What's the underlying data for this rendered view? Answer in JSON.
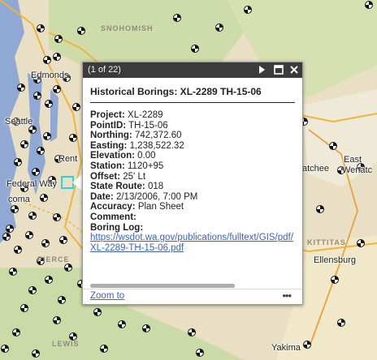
{
  "map": {
    "region_labels": [
      "SNOHOMISH",
      "KITTITAS",
      "PIERCE",
      "LEWIS"
    ],
    "cities": [
      "Edmonds",
      "Seattle",
      "Rent",
      "Federal Way",
      "coma",
      "East",
      "Wenatc",
      "atchee",
      "Ellensburg",
      "Yakima"
    ]
  },
  "popup": {
    "pager": "(1 of 22)",
    "title": "Historical Borings: XL-2289 TH-15-06",
    "fields": [
      {
        "label": "Project:",
        "value": "XL-2289"
      },
      {
        "label": "PointID:",
        "value": "TH-15-06"
      },
      {
        "label": "Northing:",
        "value": "742,372.60"
      },
      {
        "label": "Easting:",
        "value": "1,238,522.32"
      },
      {
        "label": "Elevation:",
        "value": "0.00"
      },
      {
        "label": "Station:",
        "value": "1120+95"
      },
      {
        "label": "Offset:",
        "value": "25' Lt"
      },
      {
        "label": "State Route:",
        "value": "018"
      },
      {
        "label": "Date:",
        "value": "2/13/2006, 7:00 PM"
      },
      {
        "label": "Accuracy:",
        "value": "Plan Sheet"
      },
      {
        "label": "Comment:",
        "value": ""
      },
      {
        "label": "Boring Log:",
        "value": ""
      }
    ],
    "link": "https://wsdot.wa.gov/publications/fulltext/GIS/pdf/XL-2289-TH-15-06.pdf",
    "zoom_label": "Zoom to",
    "more_label": "•••"
  },
  "icons": {
    "next": "play-icon",
    "maximize": "maximize-icon",
    "close": "close-icon"
  },
  "colors": {
    "titlebar": "#3b3b3b",
    "link": "#3a5fcd",
    "water": "#8fa8d4",
    "forest": "#c5dba2",
    "terrain": "#e9dfc4"
  }
}
